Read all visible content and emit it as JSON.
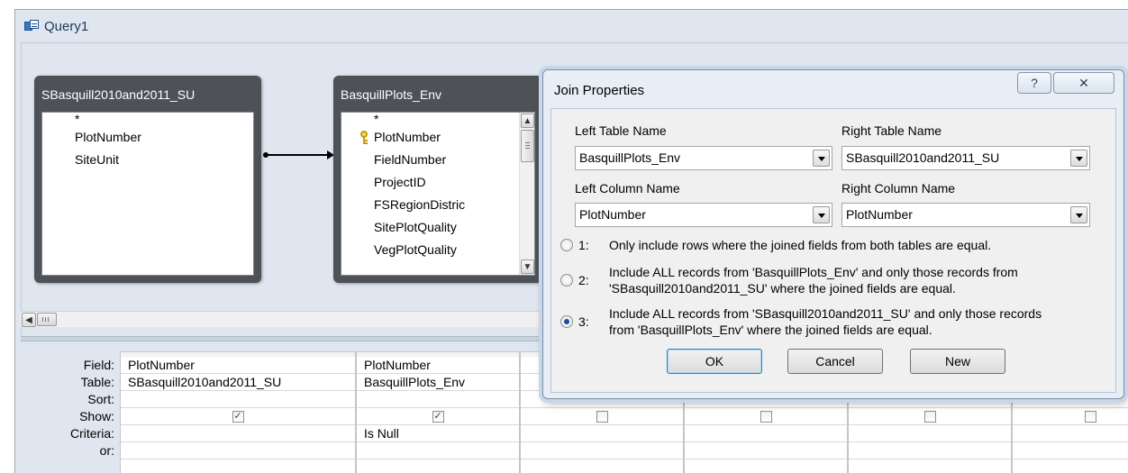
{
  "window": {
    "title": "Query1",
    "icon": "query-design-icon"
  },
  "design_pane": {
    "tables": [
      {
        "name": "SBasquill2010and2011_SU",
        "fields": [
          "*",
          "PlotNumber",
          "SiteUnit"
        ]
      },
      {
        "name": "BasquillPlots_Env",
        "fields": [
          "*",
          "PlotNumber",
          "FieldNumber",
          "ProjectID",
          "FSRegionDistric",
          "SitePlotQuality",
          "VegPlotQuality"
        ],
        "primary_key": "PlotNumber"
      }
    ],
    "scroll_icons": {
      "up": "▲",
      "down": "▼",
      "left": "◀"
    }
  },
  "qbe_grid": {
    "row_labels": [
      "Field:",
      "Table:",
      "Sort:",
      "Show:",
      "Criteria:",
      "or:"
    ],
    "columns": [
      {
        "field": "PlotNumber",
        "table": "SBasquill2010and2011_SU",
        "sort": "",
        "show": true,
        "criteria": ""
      },
      {
        "field": "PlotNumber",
        "table": "BasquillPlots_Env",
        "sort": "",
        "show": true,
        "criteria": "Is Null"
      },
      {
        "field": "",
        "table": "",
        "sort": "",
        "show": false,
        "criteria": ""
      },
      {
        "field": "",
        "table": "",
        "sort": "",
        "show": false,
        "criteria": ""
      },
      {
        "field": "",
        "table": "",
        "sort": "",
        "show": false,
        "criteria": ""
      },
      {
        "field": "",
        "table": "",
        "sort": "",
        "show": false,
        "criteria": ""
      },
      {
        "field": "",
        "table": "",
        "sort": "",
        "show": false,
        "criteria": ""
      }
    ],
    "check_mark": "✓"
  },
  "join_dialog": {
    "title": "Join Properties",
    "help": "?",
    "close": "✕",
    "left_table_label": "Left Table Name",
    "left_table_value": "BasquillPlots_Env",
    "right_table_label": "Right Table Name",
    "right_table_value": "SBasquill2010and2011_SU",
    "left_column_label": "Left Column Name",
    "left_column_value": "PlotNumber",
    "right_column_label": "Right Column Name",
    "right_column_value": "PlotNumber",
    "options": [
      {
        "num": "1:",
        "text": "Only include rows where the joined fields from both tables are equal.",
        "selected": false
      },
      {
        "num": "2:",
        "text": "Include ALL records from 'BasquillPlots_Env' and only those records from 'SBasquill2010and2011_SU' where the joined fields are equal.",
        "selected": false
      },
      {
        "num": "3:",
        "text": "Include ALL records from 'SBasquill2010and2011_SU' and only those records from 'BasquillPlots_Env' where the joined fields are equal.",
        "selected": true
      }
    ],
    "ok": "OK",
    "cancel": "Cancel",
    "new": "New"
  }
}
